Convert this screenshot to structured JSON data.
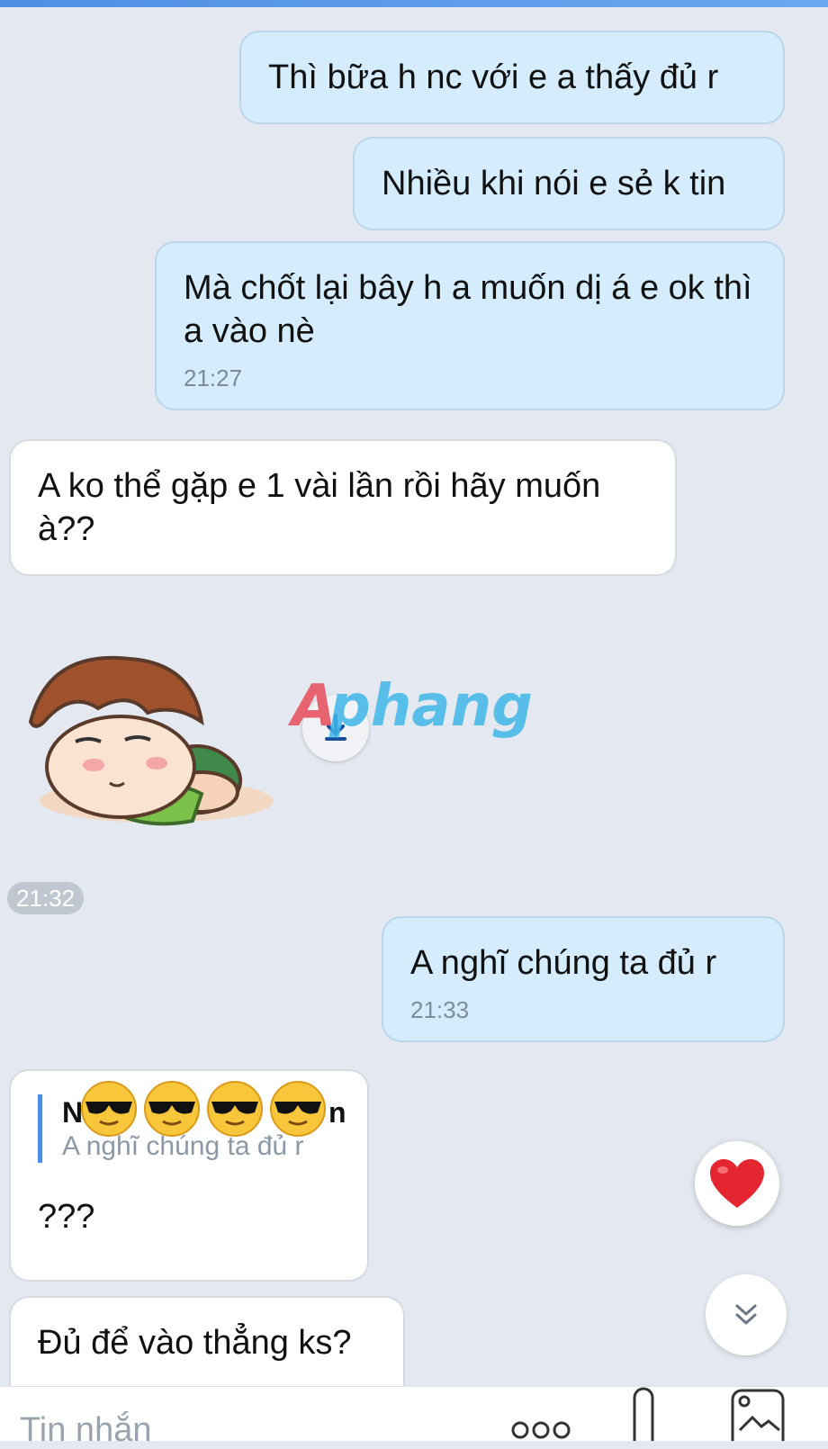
{
  "messages": {
    "m1": {
      "text": "Thì bữa h nc với e a thấy đủ r"
    },
    "m2": {
      "text": "Nhiều khi nói e sẻ k tin"
    },
    "m3": {
      "text": "Mà chốt lại bây h a muốn dị á e ok thì a vào nè",
      "time": "21:27"
    },
    "m4": {
      "text": "A ko thể gặp e 1 vài lần rồi hãy muốn à??"
    },
    "sticker": {
      "time": "21:32",
      "watermark": "Aphang"
    },
    "m5": {
      "text": "A nghĩ chúng ta đủ r",
      "time": "21:33"
    },
    "m6": {
      "quote_name": "N",
      "quote_name_end": "n",
      "quote_text": "A nghĩ chúng ta đủ r",
      "text": "???"
    },
    "m7": {
      "text": "Đủ để vào thẳng ks?"
    }
  },
  "composer": {
    "placeholder": "Tin nhắn"
  },
  "icons": {
    "reaction": "heart-icon",
    "scroll": "chevron-double-down-icon",
    "more": "more-dots-icon",
    "attach": "microphone-icon",
    "image": "image-icon",
    "download": "download-icon"
  },
  "colors": {
    "outgoing": "#d5ecfc",
    "incoming": "#ffffff",
    "background": "#e4e8f0",
    "accent": "#4d8ee0"
  }
}
